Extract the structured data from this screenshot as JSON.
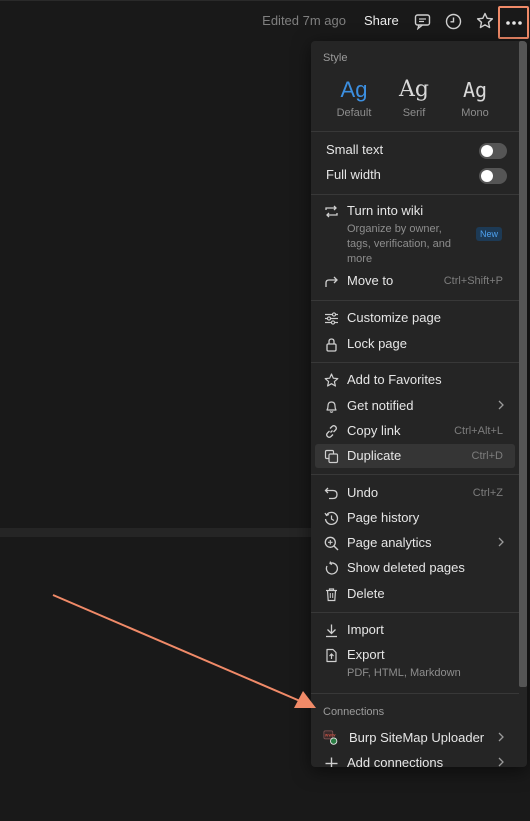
{
  "topbar": {
    "edited": "Edited 7m ago",
    "share": "Share",
    "icons": [
      "comment-icon",
      "clock-icon",
      "star-icon",
      "more-icon"
    ]
  },
  "menu": {
    "style": {
      "label": "Style",
      "options": [
        {
          "glyph": "Ag",
          "name": "Default",
          "selected": true
        },
        {
          "glyph": "Ag",
          "name": "Serif"
        },
        {
          "glyph": "Ag",
          "name": "Mono"
        }
      ]
    },
    "toggles": [
      {
        "label": "Small text",
        "on": false
      },
      {
        "label": "Full width",
        "on": false
      }
    ],
    "wiki": {
      "label": "Turn into wiki",
      "desc1": "Organize by owner,",
      "desc2": "tags, verification, and",
      "desc3": "more",
      "badge": "New"
    },
    "move_to": {
      "label": "Move to",
      "shortcut": "Ctrl+Shift+P"
    },
    "customize": {
      "label": "Customize page"
    },
    "lock": {
      "label": "Lock page"
    },
    "favorites": {
      "label": "Add to Favorites"
    },
    "notified": {
      "label": "Get notified"
    },
    "copy_link": {
      "label": "Copy link",
      "shortcut": "Ctrl+Alt+L"
    },
    "duplicate": {
      "label": "Duplicate",
      "shortcut": "Ctrl+D"
    },
    "undo": {
      "label": "Undo",
      "shortcut": "Ctrl+Z"
    },
    "history": {
      "label": "Page history"
    },
    "analytics": {
      "label": "Page analytics"
    },
    "deleted": {
      "label": "Show deleted pages"
    },
    "delete": {
      "label": "Delete"
    },
    "import": {
      "label": "Import"
    },
    "export": {
      "label": "Export",
      "desc": "PDF, HTML, Markdown"
    },
    "connections": {
      "label": "Connections",
      "items": [
        {
          "label": "Burp SiteMap Uploader"
        },
        {
          "label": "Add connections"
        }
      ]
    }
  },
  "colors": {
    "accent": "#3c8fe0",
    "highlight": "#f08a68",
    "background": "#191919",
    "menu": "#252525"
  }
}
